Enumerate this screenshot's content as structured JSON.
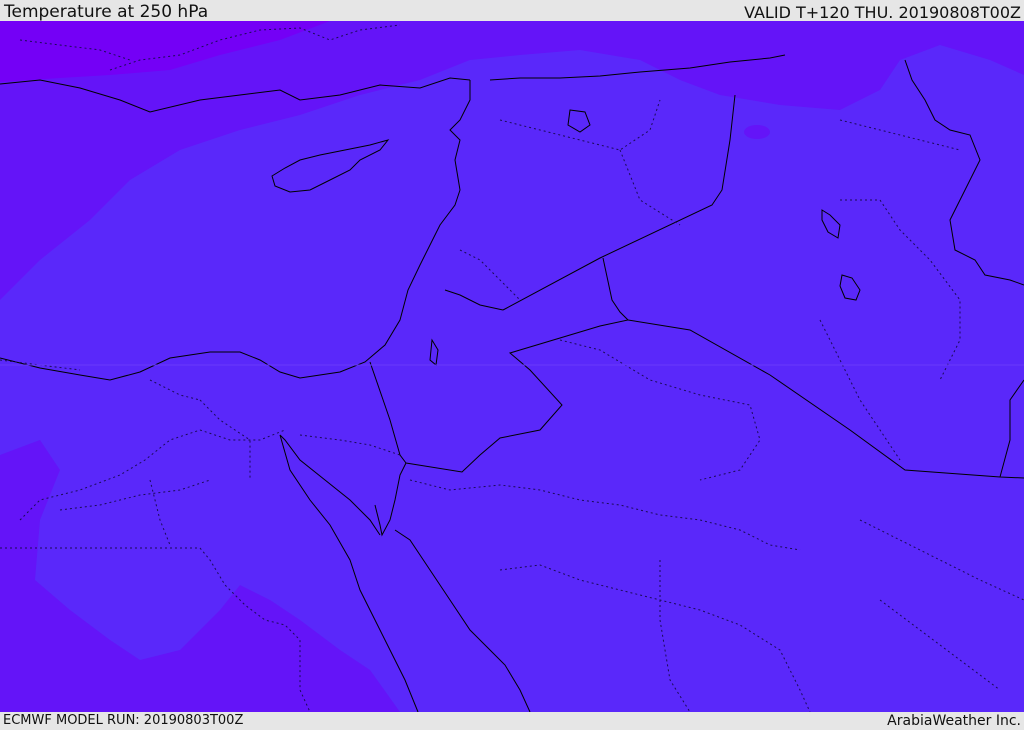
{
  "header": {
    "title": "Temperature at 250 hPa",
    "valid": "VALID T+120 THU. 20190808T00Z"
  },
  "footer": {
    "model_run": "ECMWF MODEL RUN: 20190803T00Z",
    "credit": "ArabiaWeather Inc."
  },
  "colors": {
    "warm_band": "#5a28fa",
    "cool_band": "#6414f8",
    "coldest_band": "#7400f6",
    "border_line": "#000000",
    "admin_line": "#1a0a55"
  }
}
